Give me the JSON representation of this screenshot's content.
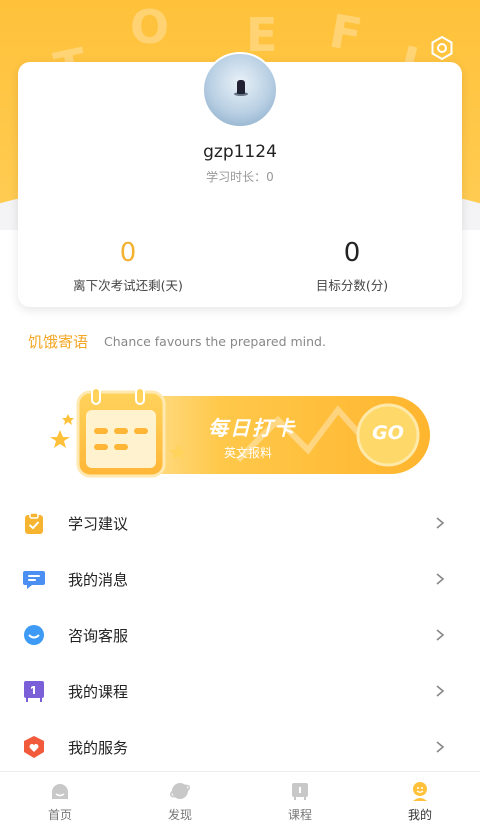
{
  "header": {
    "decoration_letters": [
      "T",
      "O",
      "E",
      "F",
      "L"
    ]
  },
  "profile": {
    "username": "gzp1124",
    "study_time_label": "学习时长：0"
  },
  "stats": {
    "days_left": {
      "value": "0",
      "label": "离下次考试还剩(天)"
    },
    "target_score": {
      "value": "0",
      "label": "目标分数(分)"
    }
  },
  "motto": {
    "tag": "饥饿寄语",
    "text": "Chance favours the prepared mind."
  },
  "banner": {
    "title": "每日打卡",
    "subtitle": "英文报料",
    "go_label": "GO"
  },
  "menu": [
    {
      "label": "学习建议",
      "icon": "clipboard-icon",
      "color": "#f6b431"
    },
    {
      "label": "我的消息",
      "icon": "message-icon",
      "color": "#4b8ff2"
    },
    {
      "label": "咨询客服",
      "icon": "support-icon",
      "color": "#3d9bf5"
    },
    {
      "label": "我的课程",
      "icon": "course-icon",
      "color": "#7a5fd8"
    },
    {
      "label": "我的服务",
      "icon": "service-icon",
      "color": "#f25a3c"
    }
  ],
  "tabs": [
    {
      "label": "首页",
      "icon": "home-icon",
      "active": false
    },
    {
      "label": "发现",
      "icon": "discover-icon",
      "active": false
    },
    {
      "label": "课程",
      "icon": "course-tab-icon",
      "active": false
    },
    {
      "label": "我的",
      "icon": "profile-icon",
      "active": true
    }
  ],
  "colors": {
    "accent": "#ffc13a",
    "accent_text": "#f5a623",
    "inactive_icon": "#c8c8c8"
  }
}
